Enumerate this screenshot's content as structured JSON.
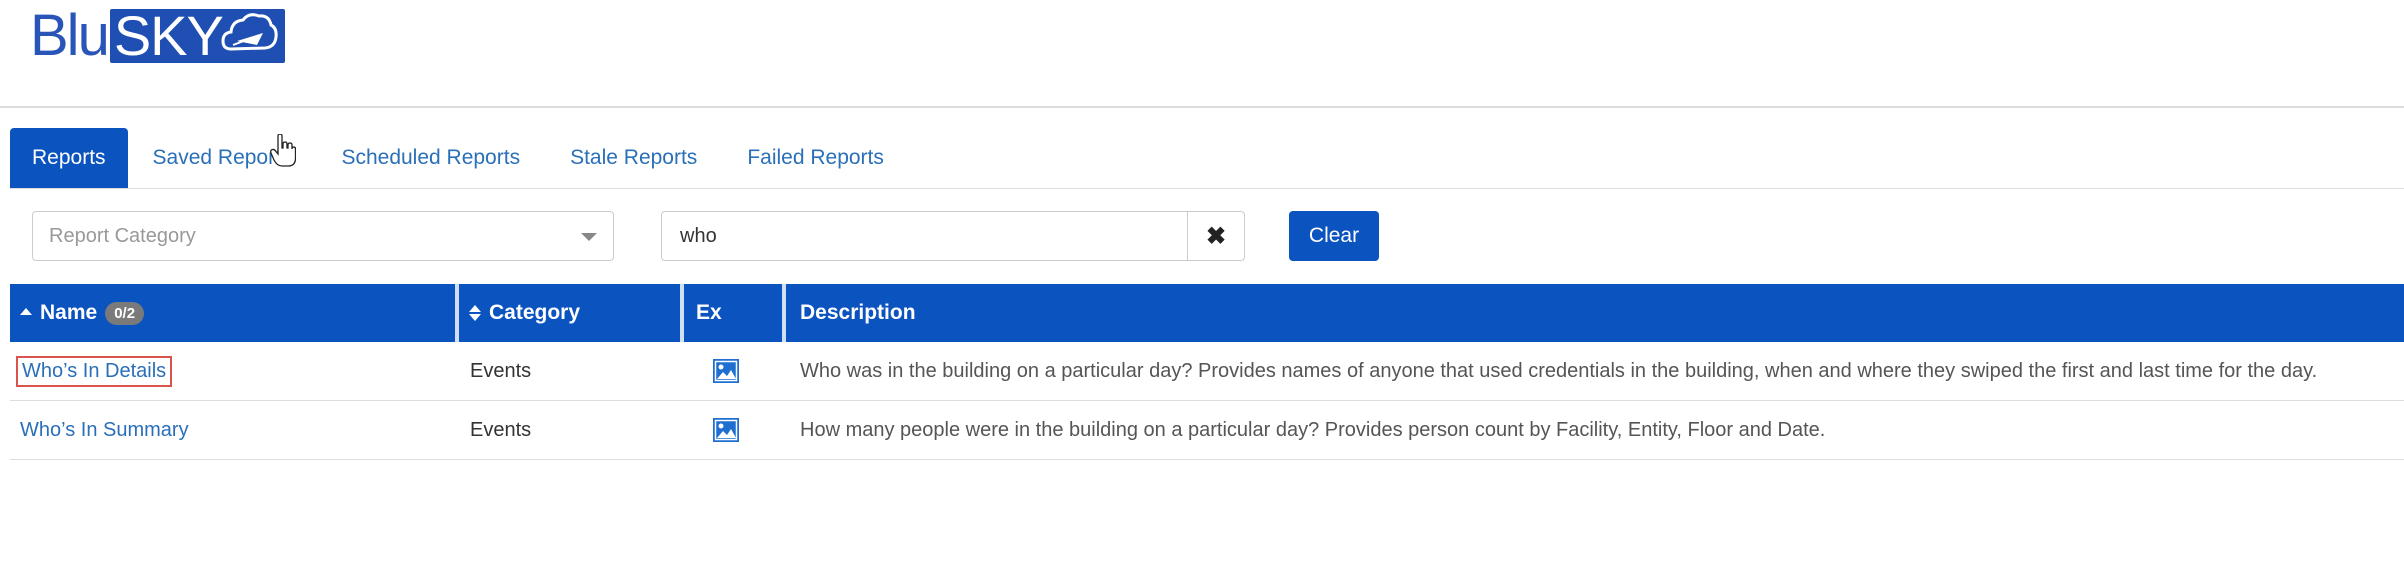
{
  "brand": {
    "logo_left": "Blu",
    "logo_right": "SKY",
    "primary_color": "#0b53bf",
    "link_color": "#2a6fb8"
  },
  "tabs": [
    {
      "label": "Reports",
      "active": true
    },
    {
      "label": "Saved Reports",
      "active": false
    },
    {
      "label": "Scheduled Reports",
      "active": false
    },
    {
      "label": "Stale Reports",
      "active": false
    },
    {
      "label": "Failed Reports",
      "active": false
    }
  ],
  "filters": {
    "category_placeholder": "Report Category",
    "search_value": "who",
    "clear_icon": "times-icon",
    "clear_label": "Clear"
  },
  "table": {
    "columns": {
      "name": "Name",
      "name_badge": "0/2",
      "category": "Category",
      "export": "Ex",
      "description": "Description"
    },
    "rows": [
      {
        "name": "Who’s In Details",
        "category": "Events",
        "export_icon": "image-icon",
        "description": "Who was in the building on a particular day? Provides names of anyone that used credentials in the building, when and where they swiped the first and last time for the day.",
        "highlighted": true
      },
      {
        "name": "Who’s In Summary",
        "category": "Events",
        "export_icon": "image-icon",
        "description": "How many people were in the building on a particular day? Provides person count by Facility, Entity, Floor and Date.",
        "highlighted": false
      }
    ]
  }
}
